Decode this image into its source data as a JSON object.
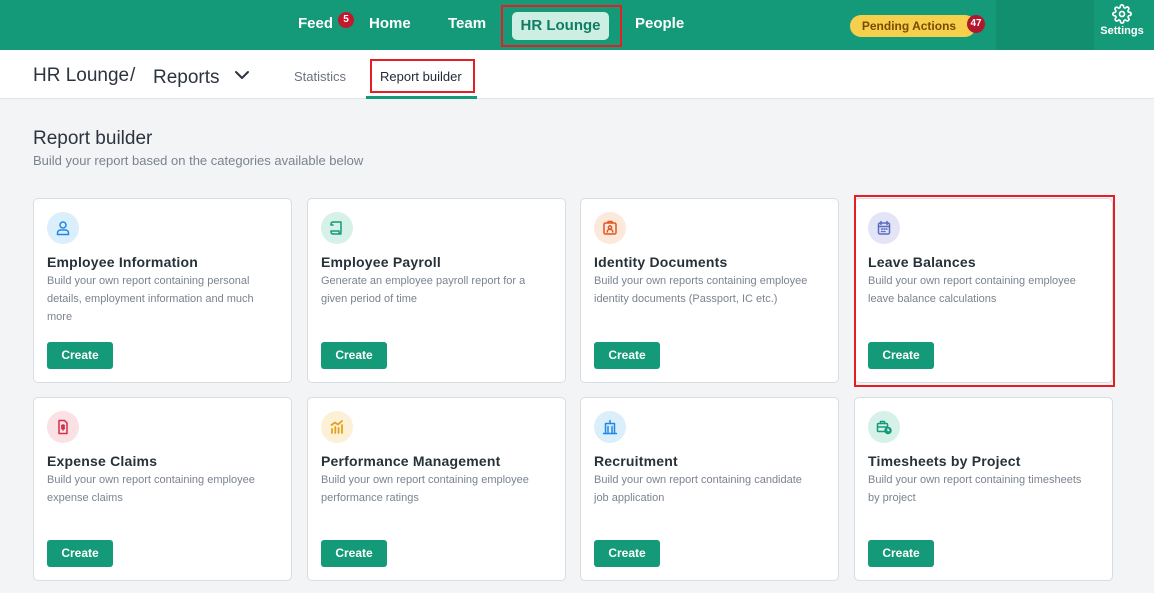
{
  "topnav": {
    "feed": "Feed",
    "feed_badge": "5",
    "home": "Home",
    "team": "Team",
    "hr_lounge": "HR Lounge",
    "people": "People",
    "pending_actions": "Pending Actions",
    "pending_badge": "47",
    "settings": "Settings"
  },
  "breadcrumb": {
    "root": "HR Lounge",
    "separator": "/",
    "current": "Reports"
  },
  "tabs": [
    "Statistics",
    "Report builder"
  ],
  "page": {
    "title": "Report builder",
    "subtitle": "Build your report based on the categories available below"
  },
  "cards": [
    {
      "title": "Employee Information",
      "desc": "Build your own report containing personal details, employment information and much more",
      "button": "Create",
      "icon": "user-icon",
      "icon_color": "#1e88e5",
      "icon_bg": "#dbeefb"
    },
    {
      "title": "Employee Payroll",
      "desc": "Generate an employee payroll report for a given period of time",
      "button": "Create",
      "icon": "scroll-icon",
      "icon_color": "#149a78",
      "icon_bg": "#d5f1e8"
    },
    {
      "title": "Identity Documents",
      "desc": "Build your own reports containing employee identity documents (Passport, IC etc.)",
      "button": "Create",
      "icon": "id-badge-icon",
      "icon_color": "#e2571e",
      "icon_bg": "#fde8dc"
    },
    {
      "title": "Leave Balances",
      "desc": "Build your own report containing employee leave balance calculations",
      "button": "Create",
      "icon": "calendar-icon",
      "icon_color": "#5c6bc0",
      "icon_bg": "#e3e5f7"
    },
    {
      "title": "Expense Claims",
      "desc": "Build your own report containing employee expense claims",
      "button": "Create",
      "icon": "receipt-icon",
      "icon_color": "#d3314a",
      "icon_bg": "#fbe0e4"
    },
    {
      "title": "Performance Management",
      "desc": "Build your own report containing employee performance ratings",
      "button": "Create",
      "icon": "bar-chart-icon",
      "icon_color": "#e0a21a",
      "icon_bg": "#fcf0d6"
    },
    {
      "title": "Recruitment",
      "desc": "Build your own report containing candidate job application",
      "button": "Create",
      "icon": "building-icon",
      "icon_color": "#1e88e5",
      "icon_bg": "#dbeefb"
    },
    {
      "title": "Timesheets by Project",
      "desc": "Build your own report containing timesheets by project",
      "button": "Create",
      "icon": "briefcase-clock-icon",
      "icon_color": "#149a78",
      "icon_bg": "#d5f1e8"
    }
  ],
  "colors": {
    "brand": "#149a78",
    "highlight": "#e31e24",
    "pending": "#f6d04d",
    "badge": "#c2192e"
  }
}
